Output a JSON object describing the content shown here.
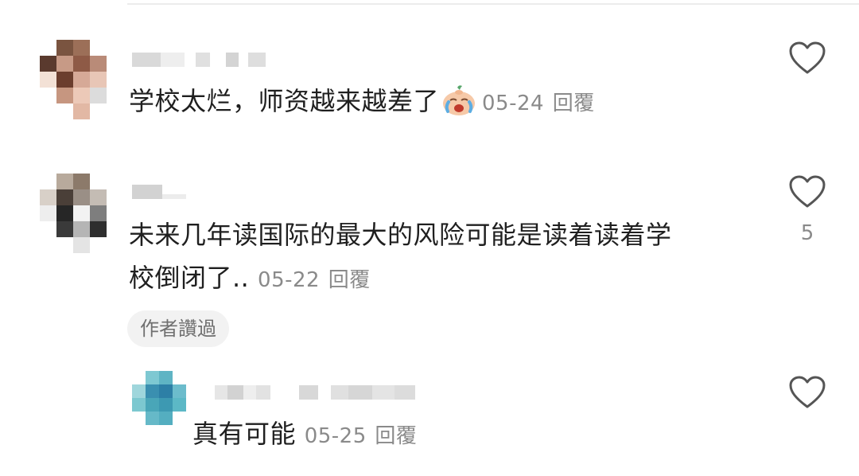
{
  "comments": [
    {
      "text": "学校太烂，师资越来越差了",
      "emoji": "crying-face-emoji",
      "date": "05-24",
      "reply_label": "回覆"
    },
    {
      "text_line1": "未来几年读国际的最大的风险可能是读着读着学",
      "text_line2": "校倒闭了..",
      "date": "05-22",
      "reply_label": "回覆",
      "likes": "5",
      "author_badge": "作者讚過"
    }
  ],
  "reply": {
    "text": "真有可能",
    "date": "05-25",
    "reply_label": "回覆"
  },
  "colors": {
    "text": "#1f1f1f",
    "meta": "#8a8a8a",
    "badge_bg": "#f2f2f2"
  }
}
